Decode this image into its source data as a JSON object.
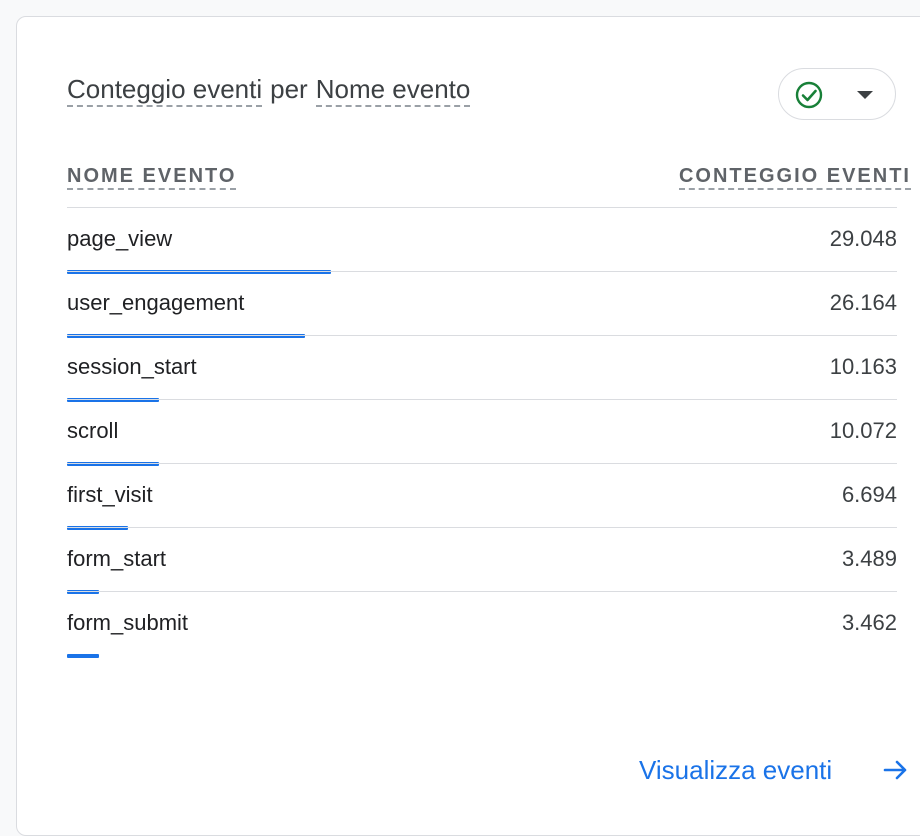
{
  "card": {
    "title_metric": "Conteggio eventi",
    "title_joiner": "per",
    "title_dimension": "Nome evento"
  },
  "compare": {
    "icon": "check-circle-icon",
    "caret_icon": "caret-down-icon",
    "accent": "#188038"
  },
  "table": {
    "columns": [
      "NOME EVENTO",
      "CONTEGGIO EVENTI"
    ],
    "max_value": 29048,
    "bar_color": "#1a73e8",
    "rows": [
      {
        "name": "page_view",
        "value": "29.048",
        "count": 29048
      },
      {
        "name": "user_engagement",
        "value": "26.164",
        "count": 26164
      },
      {
        "name": "session_start",
        "value": "10.163",
        "count": 10163
      },
      {
        "name": "scroll",
        "value": "10.072",
        "count": 10072
      },
      {
        "name": "first_visit",
        "value": "6.694",
        "count": 6694
      },
      {
        "name": "form_start",
        "value": "3.489",
        "count": 3489
      },
      {
        "name": "form_submit",
        "value": "3.462",
        "count": 3462
      }
    ]
  },
  "footer": {
    "link_label": "Visualizza eventi",
    "arrow_icon": "arrow-right-icon",
    "link_color": "#1a73e8"
  }
}
